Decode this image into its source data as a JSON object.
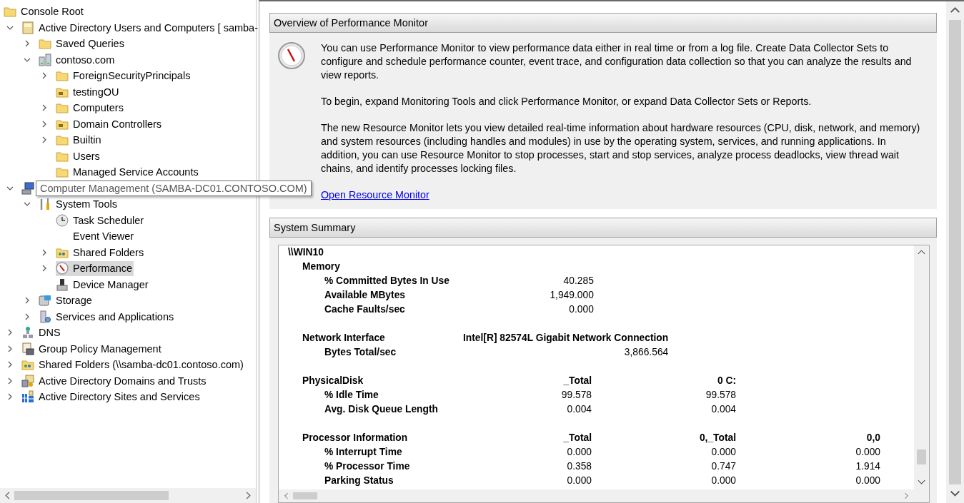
{
  "tree": {
    "items": [
      {
        "label": "Console Root",
        "kind": "folder",
        "selected": false,
        "children": [
          {
            "label": "Active Directory Users and Computers [ samba-",
            "kind": "directory",
            "expanded": true,
            "selected": false,
            "children": [
              {
                "label": "Saved Queries",
                "kind": "folder",
                "expanded": false,
                "selected": false
              },
              {
                "label": "contoso.com",
                "kind": "domain",
                "expanded": true,
                "selected": false,
                "children": [
                  {
                    "label": "ForeignSecurityPrincipals",
                    "kind": "folder",
                    "expanded": false,
                    "selected": false
                  },
                  {
                    "label": "testingOU",
                    "kind": "ou",
                    "selected": false
                  },
                  {
                    "label": "Computers",
                    "kind": "folder",
                    "expanded": false,
                    "selected": false
                  },
                  {
                    "label": "Domain Controllers",
                    "kind": "ou",
                    "expanded": false,
                    "selected": false
                  },
                  {
                    "label": "Builtin",
                    "kind": "folder",
                    "expanded": false,
                    "selected": false
                  },
                  {
                    "label": "Users",
                    "kind": "folder",
                    "selected": false
                  },
                  {
                    "label": "Managed Service Accounts",
                    "kind": "folder",
                    "selected": false
                  }
                ]
              }
            ]
          },
          {
            "tooltip": "Computer Management (SAMBA-DC01.CONTOSO.COM)",
            "kind": "computer",
            "expanded": true,
            "selected": false,
            "children": [
              {
                "label": "System Tools",
                "kind": "tools",
                "expanded": true,
                "selected": false,
                "children": [
                  {
                    "label": "Task Scheduler",
                    "kind": "clock",
                    "selected": false
                  },
                  {
                    "label": "Event Viewer",
                    "kind": "blank",
                    "selected": false
                  },
                  {
                    "label": "Shared Folders",
                    "kind": "shared",
                    "expanded": false,
                    "selected": false
                  },
                  {
                    "label": "Performance",
                    "kind": "gauge",
                    "expanded": false,
                    "selected": true
                  },
                  {
                    "label": "Device Manager",
                    "kind": "device",
                    "selected": false
                  }
                ]
              },
              {
                "label": "Storage",
                "kind": "storage",
                "expanded": false,
                "selected": false
              },
              {
                "label": "Services and Applications",
                "kind": "services",
                "expanded": false,
                "selected": false
              }
            ]
          },
          {
            "label": "DNS",
            "kind": "dns",
            "expanded": false,
            "selected": false
          },
          {
            "label": "Group Policy Management",
            "kind": "policy",
            "expanded": false,
            "selected": false
          },
          {
            "label": "Shared Folders (\\\\samba-dc01.contoso.com)",
            "kind": "shared",
            "expanded": false,
            "selected": false
          },
          {
            "label": "Active Directory Domains and Trusts",
            "kind": "trust",
            "expanded": false,
            "selected": false
          },
          {
            "label": "Active Directory Sites and Services",
            "kind": "sites",
            "expanded": false,
            "selected": false
          }
        ]
      }
    ]
  },
  "overview": {
    "title": "Overview of Performance Monitor",
    "paragraphs": [
      "You can use Performance Monitor to view performance data either in real time or from a log file. Create Data Collector Sets to configure and schedule performance counter, event trace, and configuration data collection so that you can analyze the results and view reports.",
      "To begin, expand Monitoring Tools and click Performance Monitor, or expand Data Collector Sets or Reports.",
      "The new Resource Monitor lets you view detailed real-time information about hardware resources (CPU, disk, network, and memory) and system resources (including handles and modules) in use by the operating system, services, and running applications. In addition, you can use Resource Monitor to stop processes, start and stop services, analyze process deadlocks, view thread wait chains, and identify processes locking files."
    ],
    "link": "Open Resource Monitor"
  },
  "summary": {
    "title": "System Summary",
    "host": "\\\\WIN10",
    "groups": [
      {
        "name": "Memory",
        "rows": [
          {
            "name": "% Committed Bytes In Use",
            "values": [
              "40.285"
            ]
          },
          {
            "name": "Available MBytes",
            "values": [
              "1,949.000"
            ]
          },
          {
            "name": "Cache Faults/sec",
            "values": [
              "0.000"
            ]
          }
        ]
      },
      {
        "name": "Network Interface",
        "columns": [
          "Intel[R] 82574L Gigabit Network Connection"
        ],
        "rows": [
          {
            "name": "Bytes Total/sec",
            "values": [
              "3,866.564"
            ]
          }
        ]
      },
      {
        "name": "PhysicalDisk",
        "columns": [
          "_Total",
          "0 C:"
        ],
        "rows": [
          {
            "name": "% Idle Time",
            "values": [
              "99.578",
              "99.578"
            ]
          },
          {
            "name": "Avg. Disk Queue Length",
            "values": [
              "0.004",
              "0.004"
            ]
          }
        ]
      },
      {
        "name": "Processor Information",
        "columns": [
          "_Total",
          "0,_Total",
          "0,0"
        ],
        "rows": [
          {
            "name": "% Interrupt Time",
            "values": [
              "0.000",
              "0.000",
              "0.000"
            ]
          },
          {
            "name": "% Processor Time",
            "values": [
              "0.358",
              "0.747",
              "1.914"
            ]
          },
          {
            "name": "Parking Status",
            "values": [
              "0.000",
              "0.000",
              "0.000"
            ]
          }
        ]
      }
    ]
  }
}
